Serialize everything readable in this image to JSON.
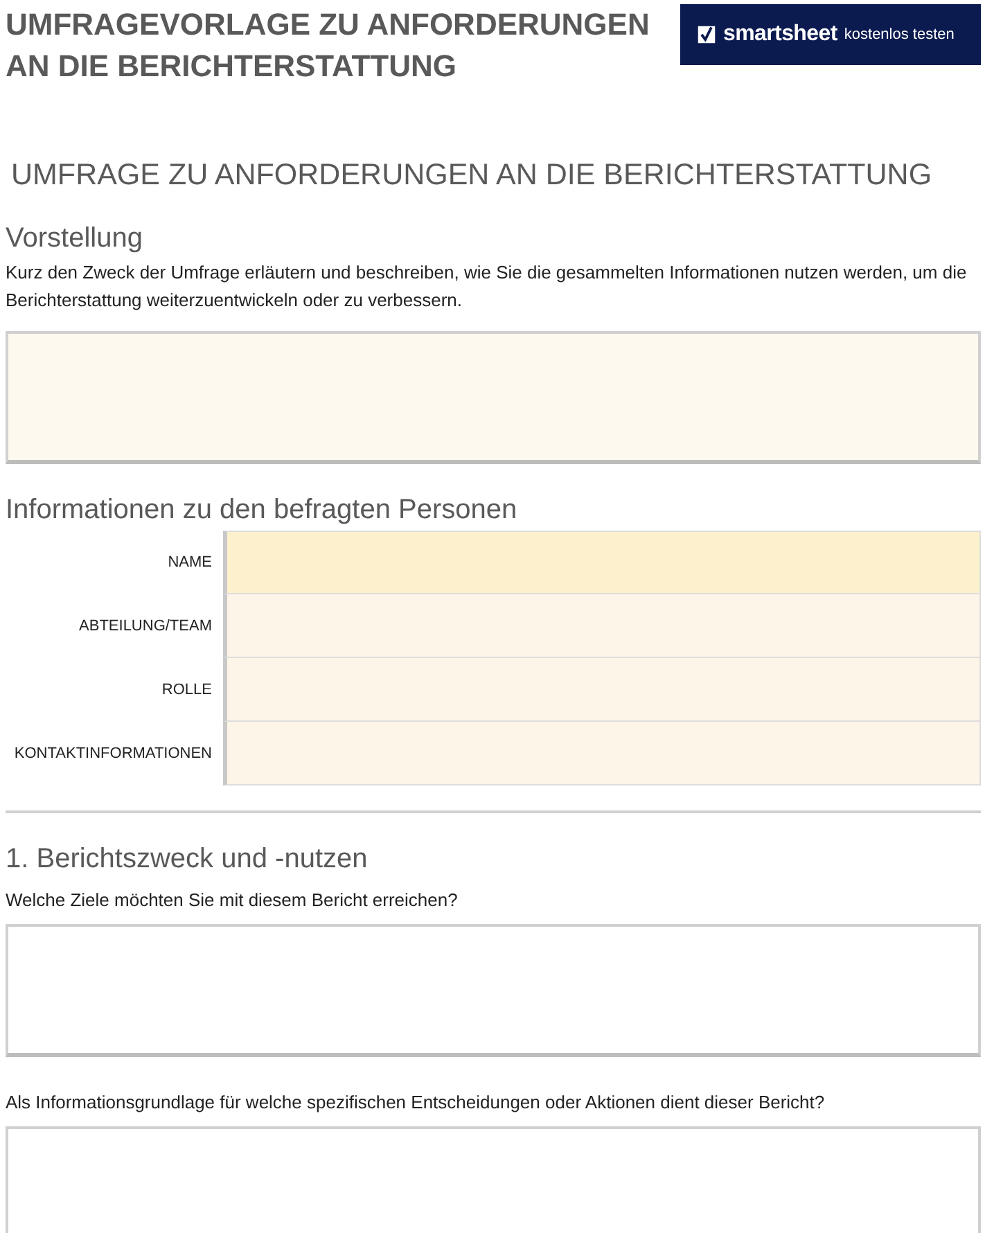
{
  "header": {
    "title": "UMFRAGEVORLAGE ZU ANFORDERUNGEN AN DIE BERICHTERSTATTUNG",
    "banner": {
      "brand": "smartsheet",
      "cta": "kostenlos testen"
    }
  },
  "subtitle": "UMFRAGE ZU ANFORDERUNGEN AN DIE BERICHTERSTATTUNG",
  "intro": {
    "heading": "Vorstellung",
    "text": "Kurz den Zweck der Umfrage erläutern und beschreiben, wie Sie die gesammelten Informationen nutzen werden, um die Berichterstattung weiterzuentwickeln oder zu verbessern."
  },
  "respondent": {
    "heading": "Informationen zu den befragten Personen",
    "fields": [
      {
        "label": "NAME",
        "selected": true
      },
      {
        "label": "ABTEILUNG/TEAM",
        "selected": false
      },
      {
        "label": "ROLLE",
        "selected": false
      },
      {
        "label": "KONTAKTINFORMATIONEN",
        "selected": false
      }
    ]
  },
  "section": {
    "heading": "1. Berichtszweck und -nutzen",
    "questions": [
      {
        "text": "Welche Ziele möchten Sie mit diesem Bericht erreichen?"
      },
      {
        "text": "Als Informationsgrundlage für welche spezifischen Entscheidungen oder Aktionen dient dieser Bericht?"
      }
    ]
  }
}
